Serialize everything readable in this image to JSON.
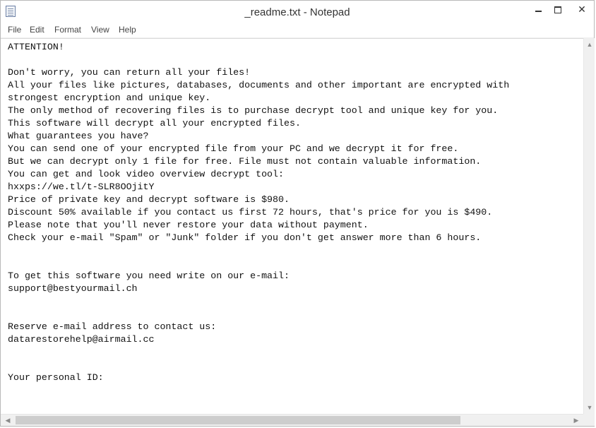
{
  "window": {
    "title": "_readme.txt - Notepad"
  },
  "controls": {
    "min": "",
    "max": "",
    "close": "✕"
  },
  "menu": [
    "File",
    "Edit",
    "Format",
    "View",
    "Help"
  ],
  "content": {
    "lines": [
      "ATTENTION!",
      "",
      "Don't worry, you can return all your files!",
      "All your files like pictures, databases, documents and other important are encrypted with",
      "strongest encryption and unique key.",
      "The only method of recovering files is to purchase decrypt tool and unique key for you.",
      "This software will decrypt all your encrypted files.",
      "What guarantees you have?",
      "You can send one of your encrypted file from your PC and we decrypt it for free.",
      "But we can decrypt only 1 file for free. File must not contain valuable information.",
      "You can get and look video overview decrypt tool:",
      "hxxps://we.tl/t-SLR8OOjitY",
      "Price of private key and decrypt software is $980.",
      "Discount 50% available if you contact us first 72 hours, that's price for you is $490.",
      "Please note that you'll never restore your data without payment.",
      "Check your e-mail \"Spam\" or \"Junk\" folder if you don't get answer more than 6 hours.",
      "",
      "",
      "To get this software you need write on our e-mail:",
      "support@bestyourmail.ch",
      "",
      "",
      "Reserve e-mail address to contact us:",
      "datarestorehelp@airmail.cc",
      "",
      "",
      "Your personal ID:"
    ]
  }
}
